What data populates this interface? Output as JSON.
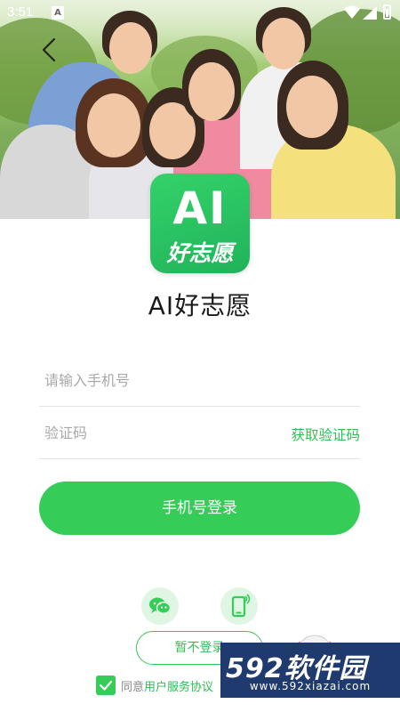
{
  "status_bar": {
    "time": "3:51",
    "sim_label": "A"
  },
  "logo": {
    "ai_text": "AI",
    "cn_text": "好志愿"
  },
  "app_name": "AI好志愿",
  "form": {
    "phone_placeholder": "请输入手机号",
    "code_placeholder": "验证码",
    "get_code_label": "获取验证码",
    "login_label": "手机号登录"
  },
  "third_party": {
    "icons": [
      "wechat-icon",
      "phone-icon"
    ]
  },
  "skip_label": "暂不登录",
  "agreement": {
    "prefix": "同意",
    "link": "用户服务协议"
  },
  "watermark": {
    "brand": "592软件园",
    "url": "www.592xiazai.com"
  },
  "colors": {
    "accent": "#35cc58",
    "accent_text": "#2fbf55"
  }
}
